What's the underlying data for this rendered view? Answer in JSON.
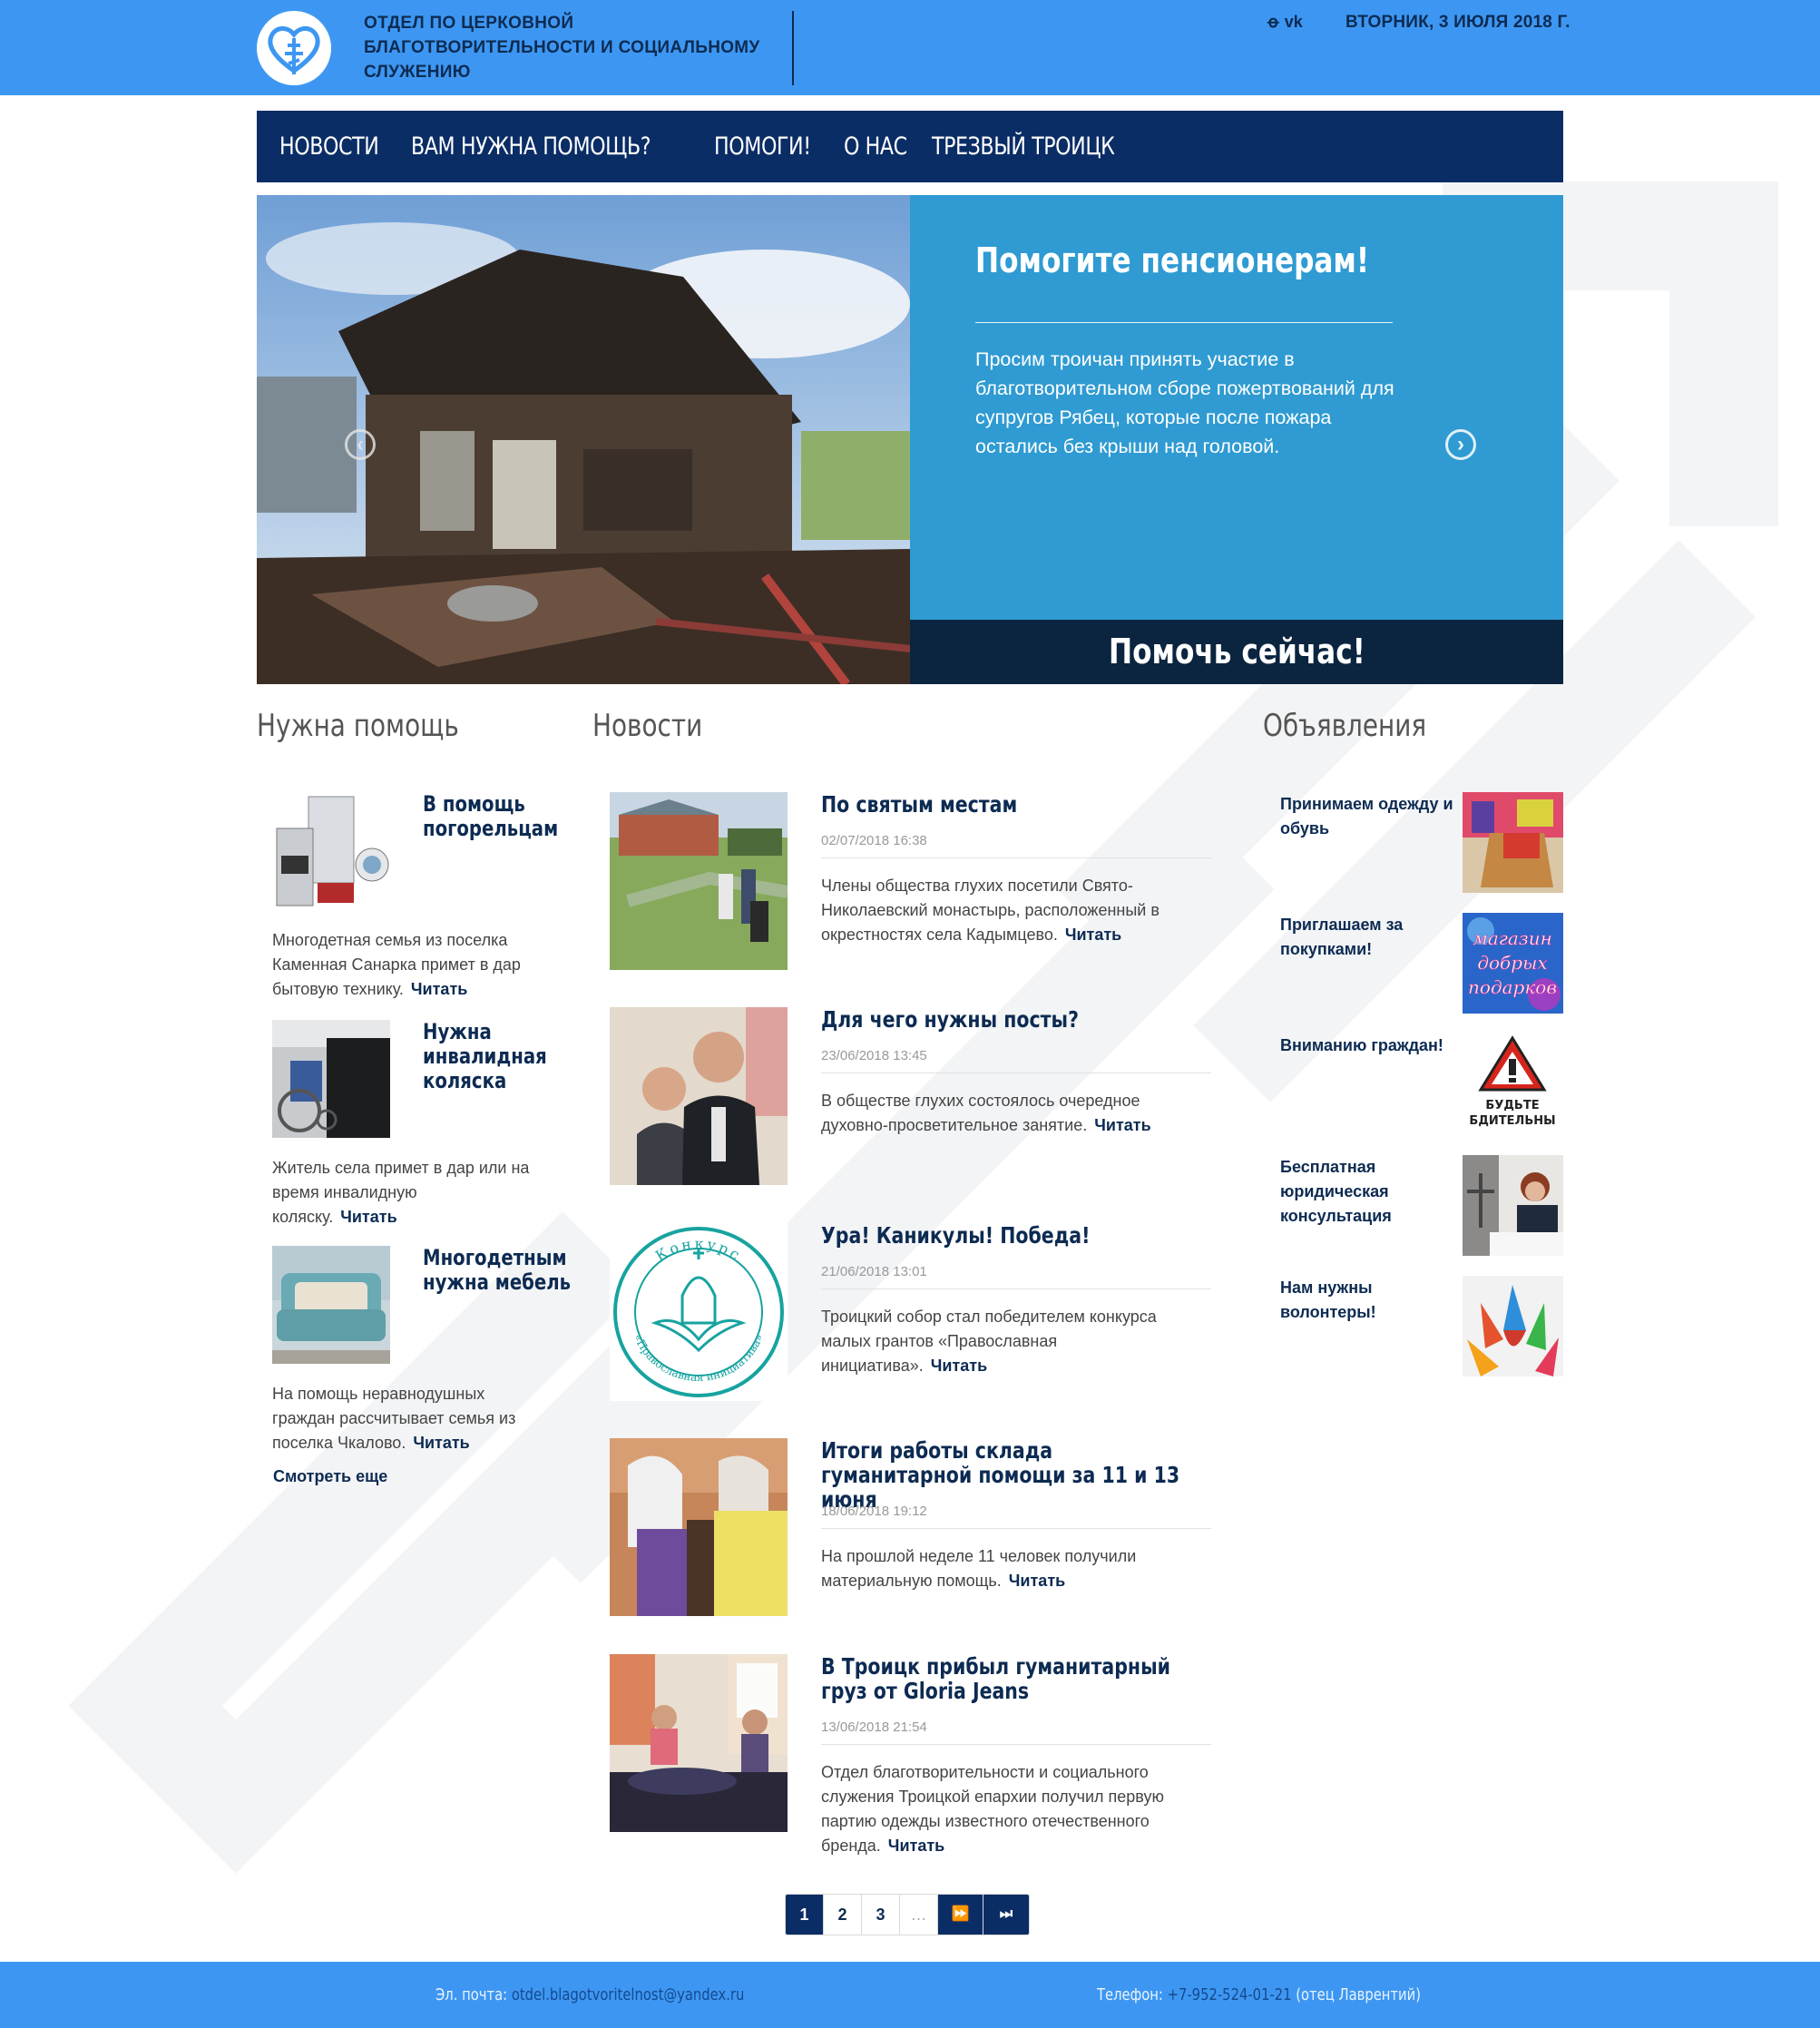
{
  "header": {
    "title_lines": [
      "ОТДЕЛ ПО ЦЕРКОВНОЙ",
      "БЛАГОТВОРИТЕЛЬНОСТИ И СОЦИАЛЬНОМУ",
      "СЛУЖЕНИЮ"
    ],
    "title_line1": "ОТДЕЛ ПО ЦЕРКОВНОЙ",
    "title_line2": "БЛАГОТВОРИТЕЛЬНОСТИ И СОЦИАЛЬНОМУ",
    "title_line3": "СЛУЖЕНИЮ",
    "date": "ВТОРНИК, 3 ИЮЛЯ 2018 Г.",
    "social": [
      {
        "icon": "odnoklassniki-icon",
        "glyph": "ꝋ"
      },
      {
        "icon": "vk-icon",
        "glyph": "vk"
      }
    ]
  },
  "nav": {
    "items": [
      {
        "label": "НОВОСТИ"
      },
      {
        "label": "ВАМ НУЖНА ПОМОЩЬ?"
      },
      {
        "label": "ПОМОГИ!"
      },
      {
        "label": "О НАС"
      },
      {
        "label": "ТРЕЗВЫЙ ТРОИЦК"
      }
    ]
  },
  "slider": {
    "title": "Помогите пенсионерам!",
    "text": "Просим троичан принять участие в благотворительном сборе пожертвований для супругов Рябец, которые после пожара остались без крыши над головой.",
    "cta": "Помочь сейчас!",
    "prev_icon": "arrow-left-icon",
    "next_icon": "arrow-right-icon"
  },
  "help": {
    "heading": "Нужна помощь",
    "read_label": "Читать",
    "more_label": "Смотреть еще",
    "items": [
      {
        "title": "В помощь погорельцам",
        "text": "Многодетная семья из поселка Каменная Санарка примет в дар бытовую технику."
      },
      {
        "title": "Нужна инвалидная коляска",
        "text": "Житель села примет в дар или на время инвалидную коляску."
      },
      {
        "title": "Многодетным нужна мебель",
        "text": "На помощь неравнодушных граждан рассчитывает семья из поселка Чкалово."
      }
    ]
  },
  "news": {
    "heading": "Новости",
    "read_label": "Читать",
    "items": [
      {
        "title": "По святым местам",
        "date": "02/07/2018 16:38",
        "text": "Члены общества глухих посетили Свято-Николаевский монастырь, расположенный в окрестностях села Кадымцево."
      },
      {
        "title": "Для чего нужны посты?",
        "date": "23/06/2018 13:45",
        "text": "В обществе глухих состоялось очередное духовно-просветительное занятие."
      },
      {
        "title": "Ура! Каникулы! Победа!",
        "date": "21/06/2018 13:01",
        "text": "Троицкий собор стал победителем конкурса малых грантов «Православная инициатива»."
      },
      {
        "title": "Итоги работы склада гуманитарной помощи за 11 и 13 июня",
        "date": "18/06/2018 19:12",
        "text": "На прошлой неделе 11 человек получили материальную помощь."
      },
      {
        "title": "В Троицк прибыл гуманитарный груз от Gloria Jeans",
        "date": "13/06/2018 21:54",
        "text": "Отдел благотворительности и социального служения Троицкой епархии получил первую партию одежды известного отечественного бренда."
      }
    ],
    "contest_badge": {
      "top": "Конкурс",
      "bottom": "«Православная инициатива»"
    }
  },
  "ads": {
    "heading": "Объявления",
    "items": [
      {
        "title": "Принимаем одежду и обувь"
      },
      {
        "title": "Приглашаем за покупками!",
        "image_text": [
          "магазин",
          "добрых",
          "подарков"
        ]
      },
      {
        "title": "Вниманию граждан!",
        "image_text": [
          "БУДЬТЕ",
          "БДИТЕЛЬНЫ"
        ]
      },
      {
        "title": "Бесплатная юридическая консультация"
      },
      {
        "title": "Нам нужны волонтеры!"
      }
    ]
  },
  "pagination": {
    "pages": [
      "1",
      "2",
      "3"
    ],
    "dots": "…",
    "current": "1",
    "next_icon": "fast-forward-icon",
    "last_icon": "skip-to-end-icon"
  },
  "footer": {
    "email_label": "Эл. почта:",
    "email": "otdel.blagotvoritelnost@yandex.ru",
    "phone_label": "Телефон:",
    "phone": "+7-952-524-01-21",
    "phone_note": "(отец Лаврентий)"
  },
  "colors": {
    "header_blue": "#3d97f2",
    "nav_navy": "#0b2d66",
    "slide_blue": "#2f9bd2",
    "cta_dark": "#0b2540",
    "text_navy": "#0d2b52"
  }
}
